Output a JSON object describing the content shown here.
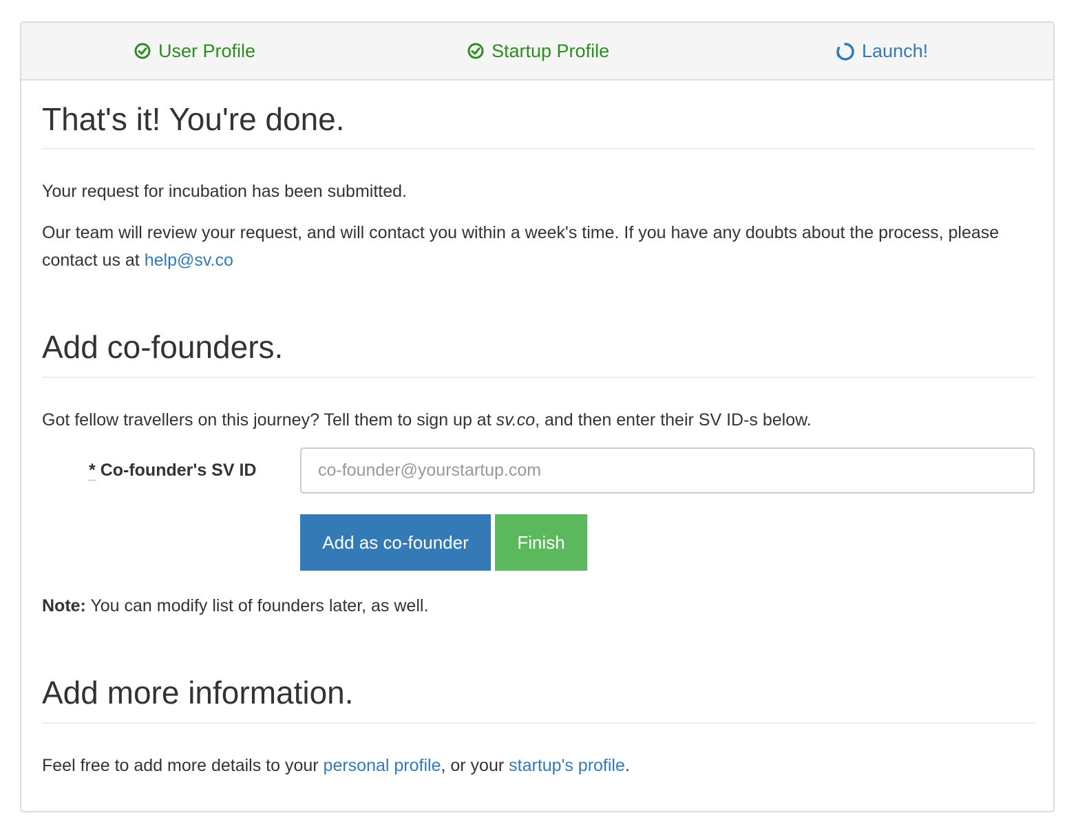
{
  "steps": [
    {
      "label": "User Profile",
      "state": "done",
      "icon": "check-circle-icon"
    },
    {
      "label": "Startup Profile",
      "state": "done",
      "icon": "check-circle-icon"
    },
    {
      "label": "Launch!",
      "state": "active",
      "icon": "spinner-icon"
    }
  ],
  "colors": {
    "done": "#2e8b22",
    "active": "#337ab7",
    "primary": "#337ab7",
    "success": "#5cb85c"
  },
  "done_section": {
    "title": "That's it! You're done.",
    "line1": "Your request for incubation has been submitted.",
    "line2_text": "Our team will review your request, and will contact you within a week's time. If you have any doubts about the process, please contact us at ",
    "email": "help@sv.co"
  },
  "cofounders": {
    "title": "Add co-founders.",
    "intro_before": "Got fellow travellers on this journey? Tell them to sign up at ",
    "intro_site": "sv.co",
    "intro_after": ", and then enter their SV ID-s below.",
    "required_mark": "*",
    "field_label": "Co-founder's SV ID",
    "field_placeholder": "co-founder@yourstartup.com",
    "field_value": "",
    "add_button": "Add as co-founder",
    "finish_button": "Finish",
    "note_bold": "Note:",
    "note_text": " You can modify list of founders later, as well."
  },
  "more_info": {
    "title": "Add more information.",
    "text_before": "Feel free to add more details to your ",
    "link_personal": "personal profile",
    "text_middle": ", or your ",
    "link_startup": "startup's profile",
    "text_after": "."
  }
}
